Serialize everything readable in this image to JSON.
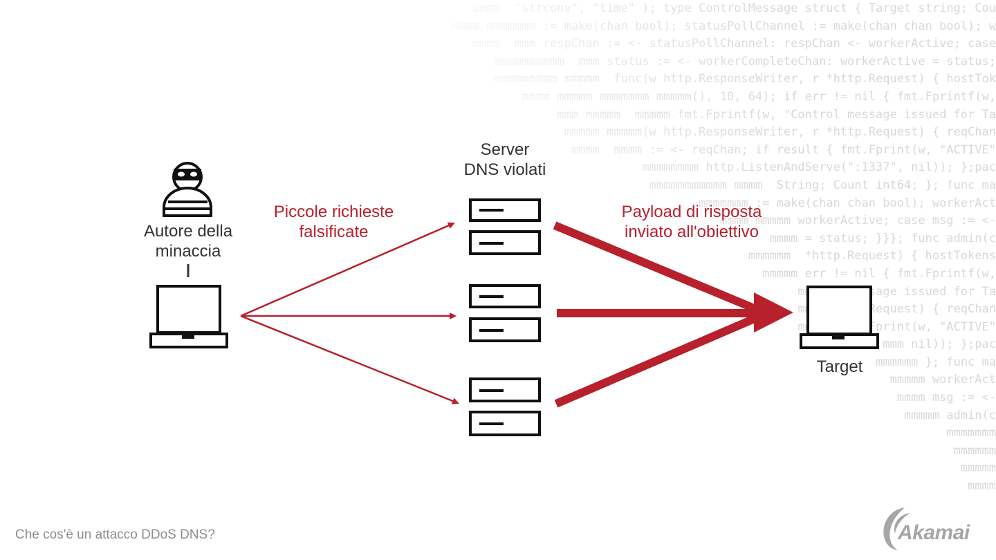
{
  "background_code": [
    "ummm  \"strconv\", \"time\" ); type ControlMessage struct { Target string; Cou",
    "mmmm mmmmmmm := make(chan bool); statusPollChannel := make(chan chan bool); w",
    "mmmm  mmm respChan := <- statusPollChannel: respChan <- workerActive; case",
    "mmmmmmmmmm  mmm status := <- workerCompleteChan: workerActive = status;",
    "mmmmmmmmm mmmmm  func(w http.ResponseWriter, r *http.Request) { hostTok",
    "mmmm mmmmm mmmmmmm mmmmm(), 10, 64); if err != nil { fmt.Fprintf(w,",
    "mmm mmmmm  mmmmm fmt.Fprintf(w, \"Control message issued for Ta",
    "mmmmm mmmmm(w http.ResponseWriter, r *http.Request) { reqChan",
    "mmmm  mmmm := <- reqChan; if result { fmt.Fprint(w, \"ACTIVE\"",
    "mmmmmmmm http.ListenAndServe(\":1337\", nil)); };pac",
    "mmmmmmmmmmm mmmm  String; Count int64; }; func ma",
    "mmmmmmm := make(chan chan bool); workerAct",
    "mmmm mmmmm workerActive; case msg := <-",
    "mmmm = status; }}}; func admin(c",
    "mmmmmm  *http.Request) { hostTokens",
    "mmmmm err != nil { fmt.Fprintf(w,",
    "mmmmmm message issued for Ta",
    "mmmmm mmm Request) { reqChan",
    "mmmmm fmt.Fprint(w, \"ACTIVE\"",
    "mmmmm mmm nil)); };pac",
    "mmmmmm }; func ma",
    "mmmmm workerAct",
    "mmmm msg := <-",
    "mmmmm admin(c",
    "mmmmmmm",
    "mmmmmm",
    "mmmmm",
    "mmmm"
  ],
  "nodes": {
    "attacker_label": "Autore della minaccia",
    "servers_label": "Server DNS violati",
    "target_label": "Target"
  },
  "edges": {
    "spoofed_requests_label": "Piccole richieste falsificate",
    "payload_label": "Payload di risposta inviato all'obiettivo"
  },
  "caption": "Che cos'è un attacco DDoS DNS?",
  "brand": {
    "name": "Akamai"
  },
  "colors": {
    "accent": "#b8202c",
    "text": "#333333",
    "caption": "#8e8e8e",
    "logo": "#a6a6a6"
  }
}
